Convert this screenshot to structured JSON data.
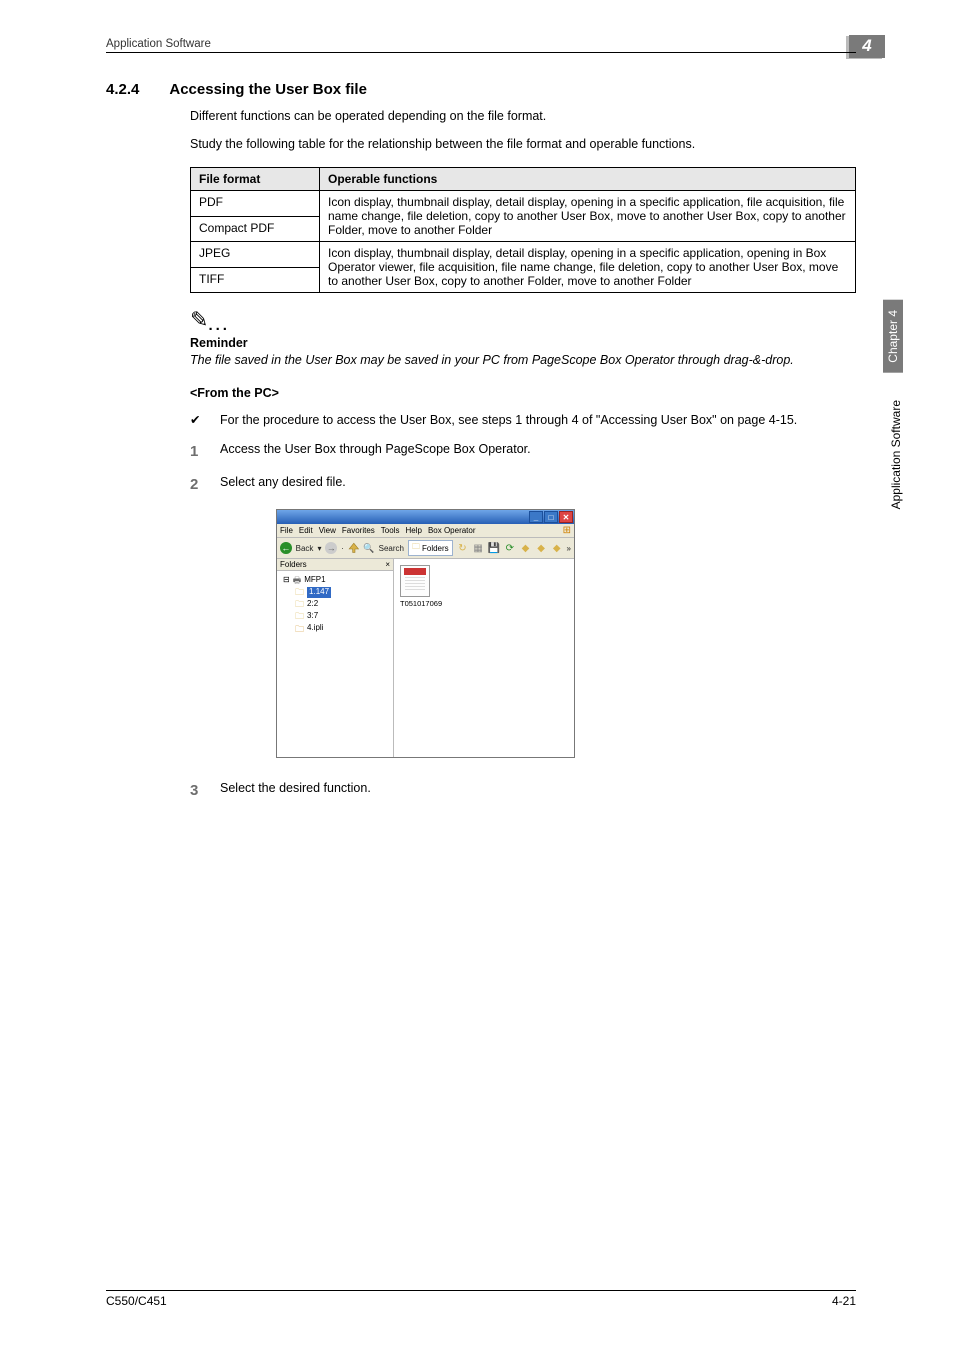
{
  "runningHead": "Application Software",
  "chapterTab": "4",
  "section": {
    "number": "4.2.4",
    "title": "Accessing the User Box file"
  },
  "intro1": "Different functions can be operated depending on the file format.",
  "intro2": "Study the following table for the relationship between the file format and operable functions.",
  "table": {
    "headers": [
      "File format",
      "Operable functions"
    ],
    "rows": {
      "r1c1": "PDF",
      "r2c1": "Compact PDF",
      "r12c2": "Icon display, thumbnail display, detail display, opening in a specific application, file acquisition, file name change, file deletion, copy to another User Box, move to another User Box, copy to another Folder, move to another Folder",
      "r3c1": "JPEG",
      "r4c1": "TIFF",
      "r34c2": "Icon display, thumbnail display, detail display, opening in a specific application, opening in Box Operator viewer, file acquisition, file name change, file deletion, copy to another User Box, move to another User Box, copy to another Folder, move to another Folder"
    }
  },
  "reminder": {
    "label": "Reminder",
    "text": "The file saved in the User Box may be saved in your PC from PageScope Box Operator through drag-&-drop."
  },
  "subhead": "<From the PC>",
  "checkItem": "For the procedure to access the User Box, see steps 1 through 4 of \"Accessing User Box\" on page 4-15.",
  "steps": {
    "s1": "Access the User Box through PageScope Box Operator.",
    "s2": "Select any desired file.",
    "s3": "Select the desired function."
  },
  "screenshot": {
    "menu": [
      "File",
      "Edit",
      "View",
      "Favorites",
      "Tools",
      "Help",
      "Box Operator"
    ],
    "toolbar": {
      "back": "Back",
      "search": "Search",
      "folders": "Folders"
    },
    "foldersPane": "Folders",
    "tree": {
      "root": "MFP1",
      "sel": "1.147",
      "n2": "2:2",
      "n3": "3:7",
      "n4": "4.ipli"
    },
    "file": "T051017069"
  },
  "sideTab": {
    "chapter": "Chapter 4",
    "app": "Application Software"
  },
  "footer": {
    "model": "C550/C451",
    "page": "4-21"
  }
}
